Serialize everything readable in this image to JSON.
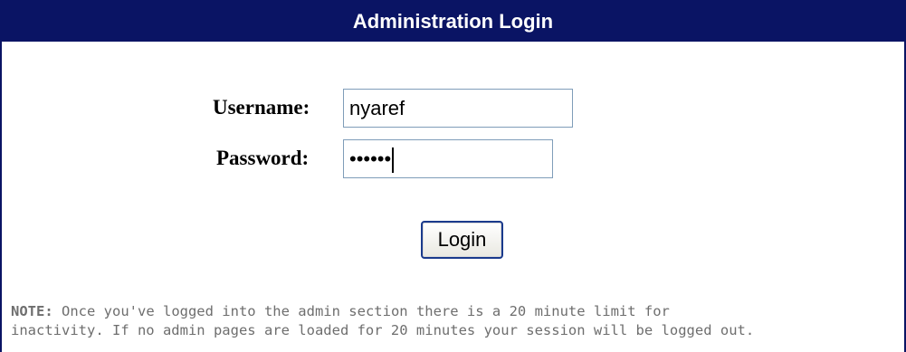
{
  "window": {
    "title": "Administration Login"
  },
  "form": {
    "username_label": "Username:",
    "username_value": "nyaref",
    "password_label": "Password:",
    "password_mask": "••••••",
    "login_label": "Login"
  },
  "note": {
    "prefix": "NOTE:",
    "line1": " Once you've logged into the admin section there is a 20 minute limit for",
    "line2": "inactivity. If no admin pages are loaded for 20 minutes your session will be logged out."
  },
  "colors": {
    "titlebar": "#0a1464",
    "note_text": "#6e6e6e"
  }
}
